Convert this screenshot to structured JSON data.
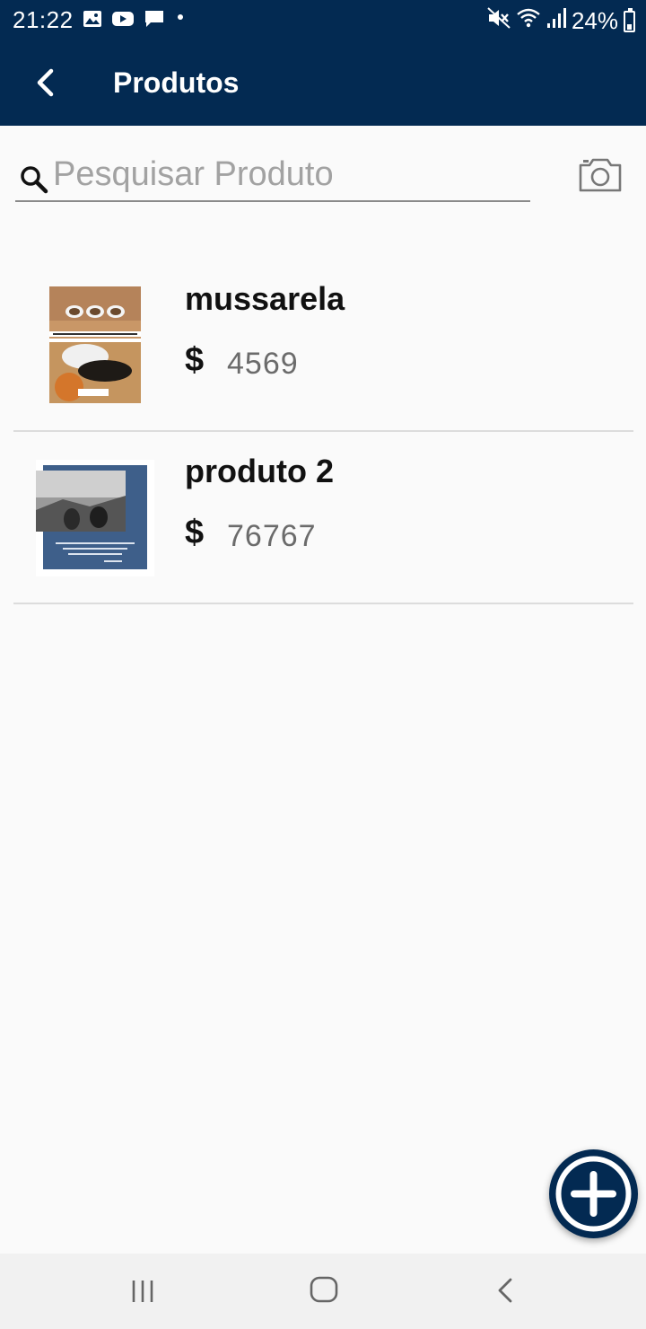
{
  "status_bar": {
    "time": "21:22",
    "battery": "24%",
    "notification_icons": [
      "image-icon",
      "youtube-icon",
      "message-icon"
    ],
    "system_icons": [
      "mute-icon",
      "wifi-icon",
      "signal-icon",
      "battery-icon"
    ]
  },
  "app_bar": {
    "title": "Produtos",
    "background_color": "#032a52",
    "back_icon": "chevron-left-icon"
  },
  "search": {
    "placeholder": "Pesquisar Produto",
    "value": "",
    "icon": "search-icon",
    "camera_icon": "camera-icon"
  },
  "products": [
    {
      "name": "mussarela",
      "currency": "$",
      "price": "4569",
      "thumbnail": "cat-bowls-photo"
    },
    {
      "name": "produto 2",
      "currency": "$",
      "price": "76767",
      "thumbnail": "landscape-card-photo"
    }
  ],
  "fab": {
    "icon": "plus-icon",
    "color": "#032a52"
  },
  "navigation_bar": {
    "icons": [
      "recents-icon",
      "home-icon",
      "back-icon"
    ]
  }
}
